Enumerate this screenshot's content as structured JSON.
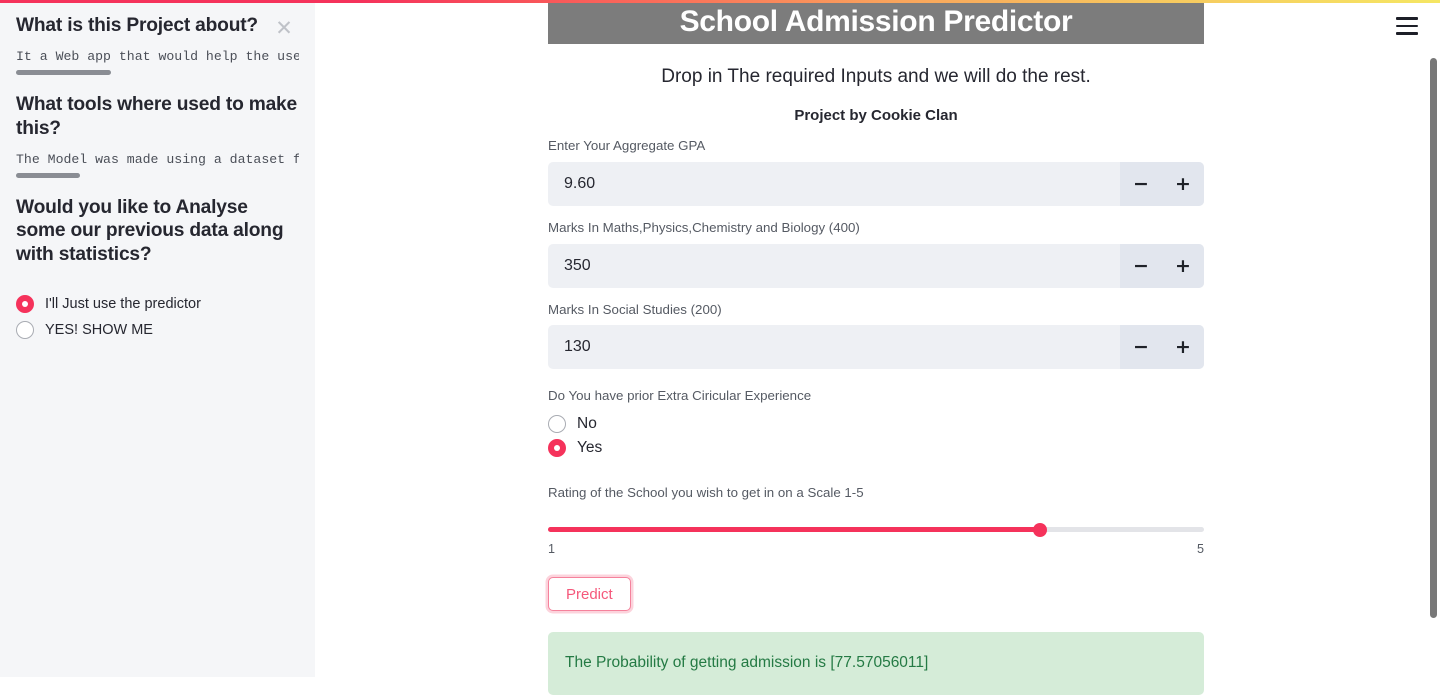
{
  "top_bar": {
    "gradient_from": "#f5325b",
    "gradient_to": "#f5e663"
  },
  "sidebar": {
    "close_label": "✕",
    "sections": [
      {
        "heading": "What is this Project about?",
        "code": "It a Web app that would help the user ir"
      },
      {
        "heading": "What tools where used to make this?",
        "code": "The Model was made using a dataset from"
      }
    ],
    "radio_question": "Would you like to Analyse some our previous data along with statistics?",
    "radio_options": [
      {
        "label": "I'll Just use the predictor",
        "selected": true
      },
      {
        "label": "YES! SHOW ME",
        "selected": false
      }
    ]
  },
  "topbar": {
    "menu_icon": "hamburger-icon"
  },
  "main": {
    "app_title": "School Admission Predictor",
    "subtitle": "Drop in The required Inputs and we will do the rest.",
    "byline": "Project by Cookie Clan",
    "number_fields": [
      {
        "label": "Enter Your Aggregate GPA",
        "value": "9.60",
        "decrement": "−",
        "increment": "+"
      },
      {
        "label": "Marks In Maths,Physics,Chemistry and Biology (400)",
        "value": "350",
        "decrement": "−",
        "increment": "+"
      },
      {
        "label": "Marks In Social Studies (200)",
        "value": "130",
        "decrement": "−",
        "increment": "+"
      }
    ],
    "experience": {
      "label": "Do You have prior Extra Ciricular Experience",
      "options": [
        {
          "label": "No",
          "selected": false
        },
        {
          "label": "Yes",
          "selected": true
        }
      ]
    },
    "slider": {
      "label": "Rating of the School you wish to get in on a Scale 1-5",
      "min_tick": "1",
      "max_tick": "5",
      "value": 4,
      "min": 1,
      "max": 5,
      "fill_percent": "75%",
      "accent": "#f5325b"
    },
    "predict_button": "Predict",
    "result": {
      "text": "The Probability of getting admission is [77.57056011]",
      "background": "#d5ecd8",
      "color": "#247a44"
    }
  }
}
